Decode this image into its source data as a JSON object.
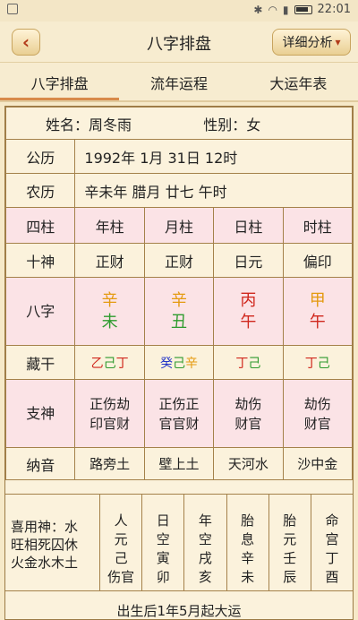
{
  "status": {
    "time": "22:01"
  },
  "header": {
    "title": "八字排盘",
    "detail_label": "详细分析"
  },
  "tabs": [
    "八字排盘",
    "流年运程",
    "大运年表"
  ],
  "info": {
    "name": "姓名：周冬雨",
    "gender": "性别：女",
    "gongli_label": "公历",
    "gongli_value": "1992年 1月 31日 12时",
    "nongli_label": "农历",
    "nongli_value": "辛未年 腊月 廿七 午时"
  },
  "columns": {
    "label": "四柱",
    "items": [
      "年柱",
      "月柱",
      "日柱",
      "时柱"
    ]
  },
  "shishen": {
    "label": "十神",
    "items": [
      "正财",
      "正财",
      "日元",
      "偏印"
    ]
  },
  "bazi": {
    "label": "八字",
    "pillars": [
      {
        "gan": "辛",
        "gan_color": "#e49a10",
        "zhi": "未",
        "zhi_color": "#2e9b2e"
      },
      {
        "gan": "辛",
        "gan_color": "#e49a10",
        "zhi": "丑",
        "zhi_color": "#2e9b2e"
      },
      {
        "gan": "丙",
        "gan_color": "#d0281e",
        "zhi": "午",
        "zhi_color": "#d0281e"
      },
      {
        "gan": "甲",
        "gan_color": "#e49a10",
        "zhi": "午",
        "zhi_color": "#d0281e"
      }
    ]
  },
  "canggan": {
    "label": "藏干",
    "items": [
      [
        {
          "t": "乙",
          "c": "#d0281e"
        },
        {
          "t": "己",
          "c": "#2e9b2e"
        },
        {
          "t": "丁",
          "c": "#d0281e"
        }
      ],
      [
        {
          "t": "癸",
          "c": "#2436c8"
        },
        {
          "t": "己",
          "c": "#2e9b2e"
        },
        {
          "t": "辛",
          "c": "#e49a10"
        }
      ],
      [
        {
          "t": "丁",
          "c": "#d0281e"
        },
        {
          "t": "己",
          "c": "#2e9b2e"
        }
      ],
      [
        {
          "t": "丁",
          "c": "#d0281e"
        },
        {
          "t": "己",
          "c": "#2e9b2e"
        }
      ]
    ]
  },
  "zhishen": {
    "label": "支神",
    "items": [
      [
        "正伤劫",
        "印官财"
      ],
      [
        "正伤正",
        "官官财"
      ],
      [
        "劫伤",
        "财官"
      ],
      [
        "劫伤",
        "财官"
      ]
    ]
  },
  "nayin": {
    "label": "纳音",
    "items": [
      "路旁土",
      "壁上土",
      "天河水",
      "沙中金"
    ]
  },
  "bottom": {
    "xiyong": "喜用神：水",
    "wangxiang_1": "旺相死囚休",
    "wangxiang_2": "火金水木土",
    "columns": [
      [
        "人",
        "元",
        "己",
        "伤官"
      ],
      [
        "日",
        "空",
        "寅",
        "卯"
      ],
      [
        "年",
        "空",
        "戌",
        "亥"
      ],
      [
        "胎",
        "息",
        "辛",
        "未"
      ],
      [
        "胎",
        "元",
        "壬",
        "辰"
      ],
      [
        "命",
        "宫",
        "丁",
        "酉"
      ]
    ],
    "footer": "出生后1年5月起大运"
  }
}
